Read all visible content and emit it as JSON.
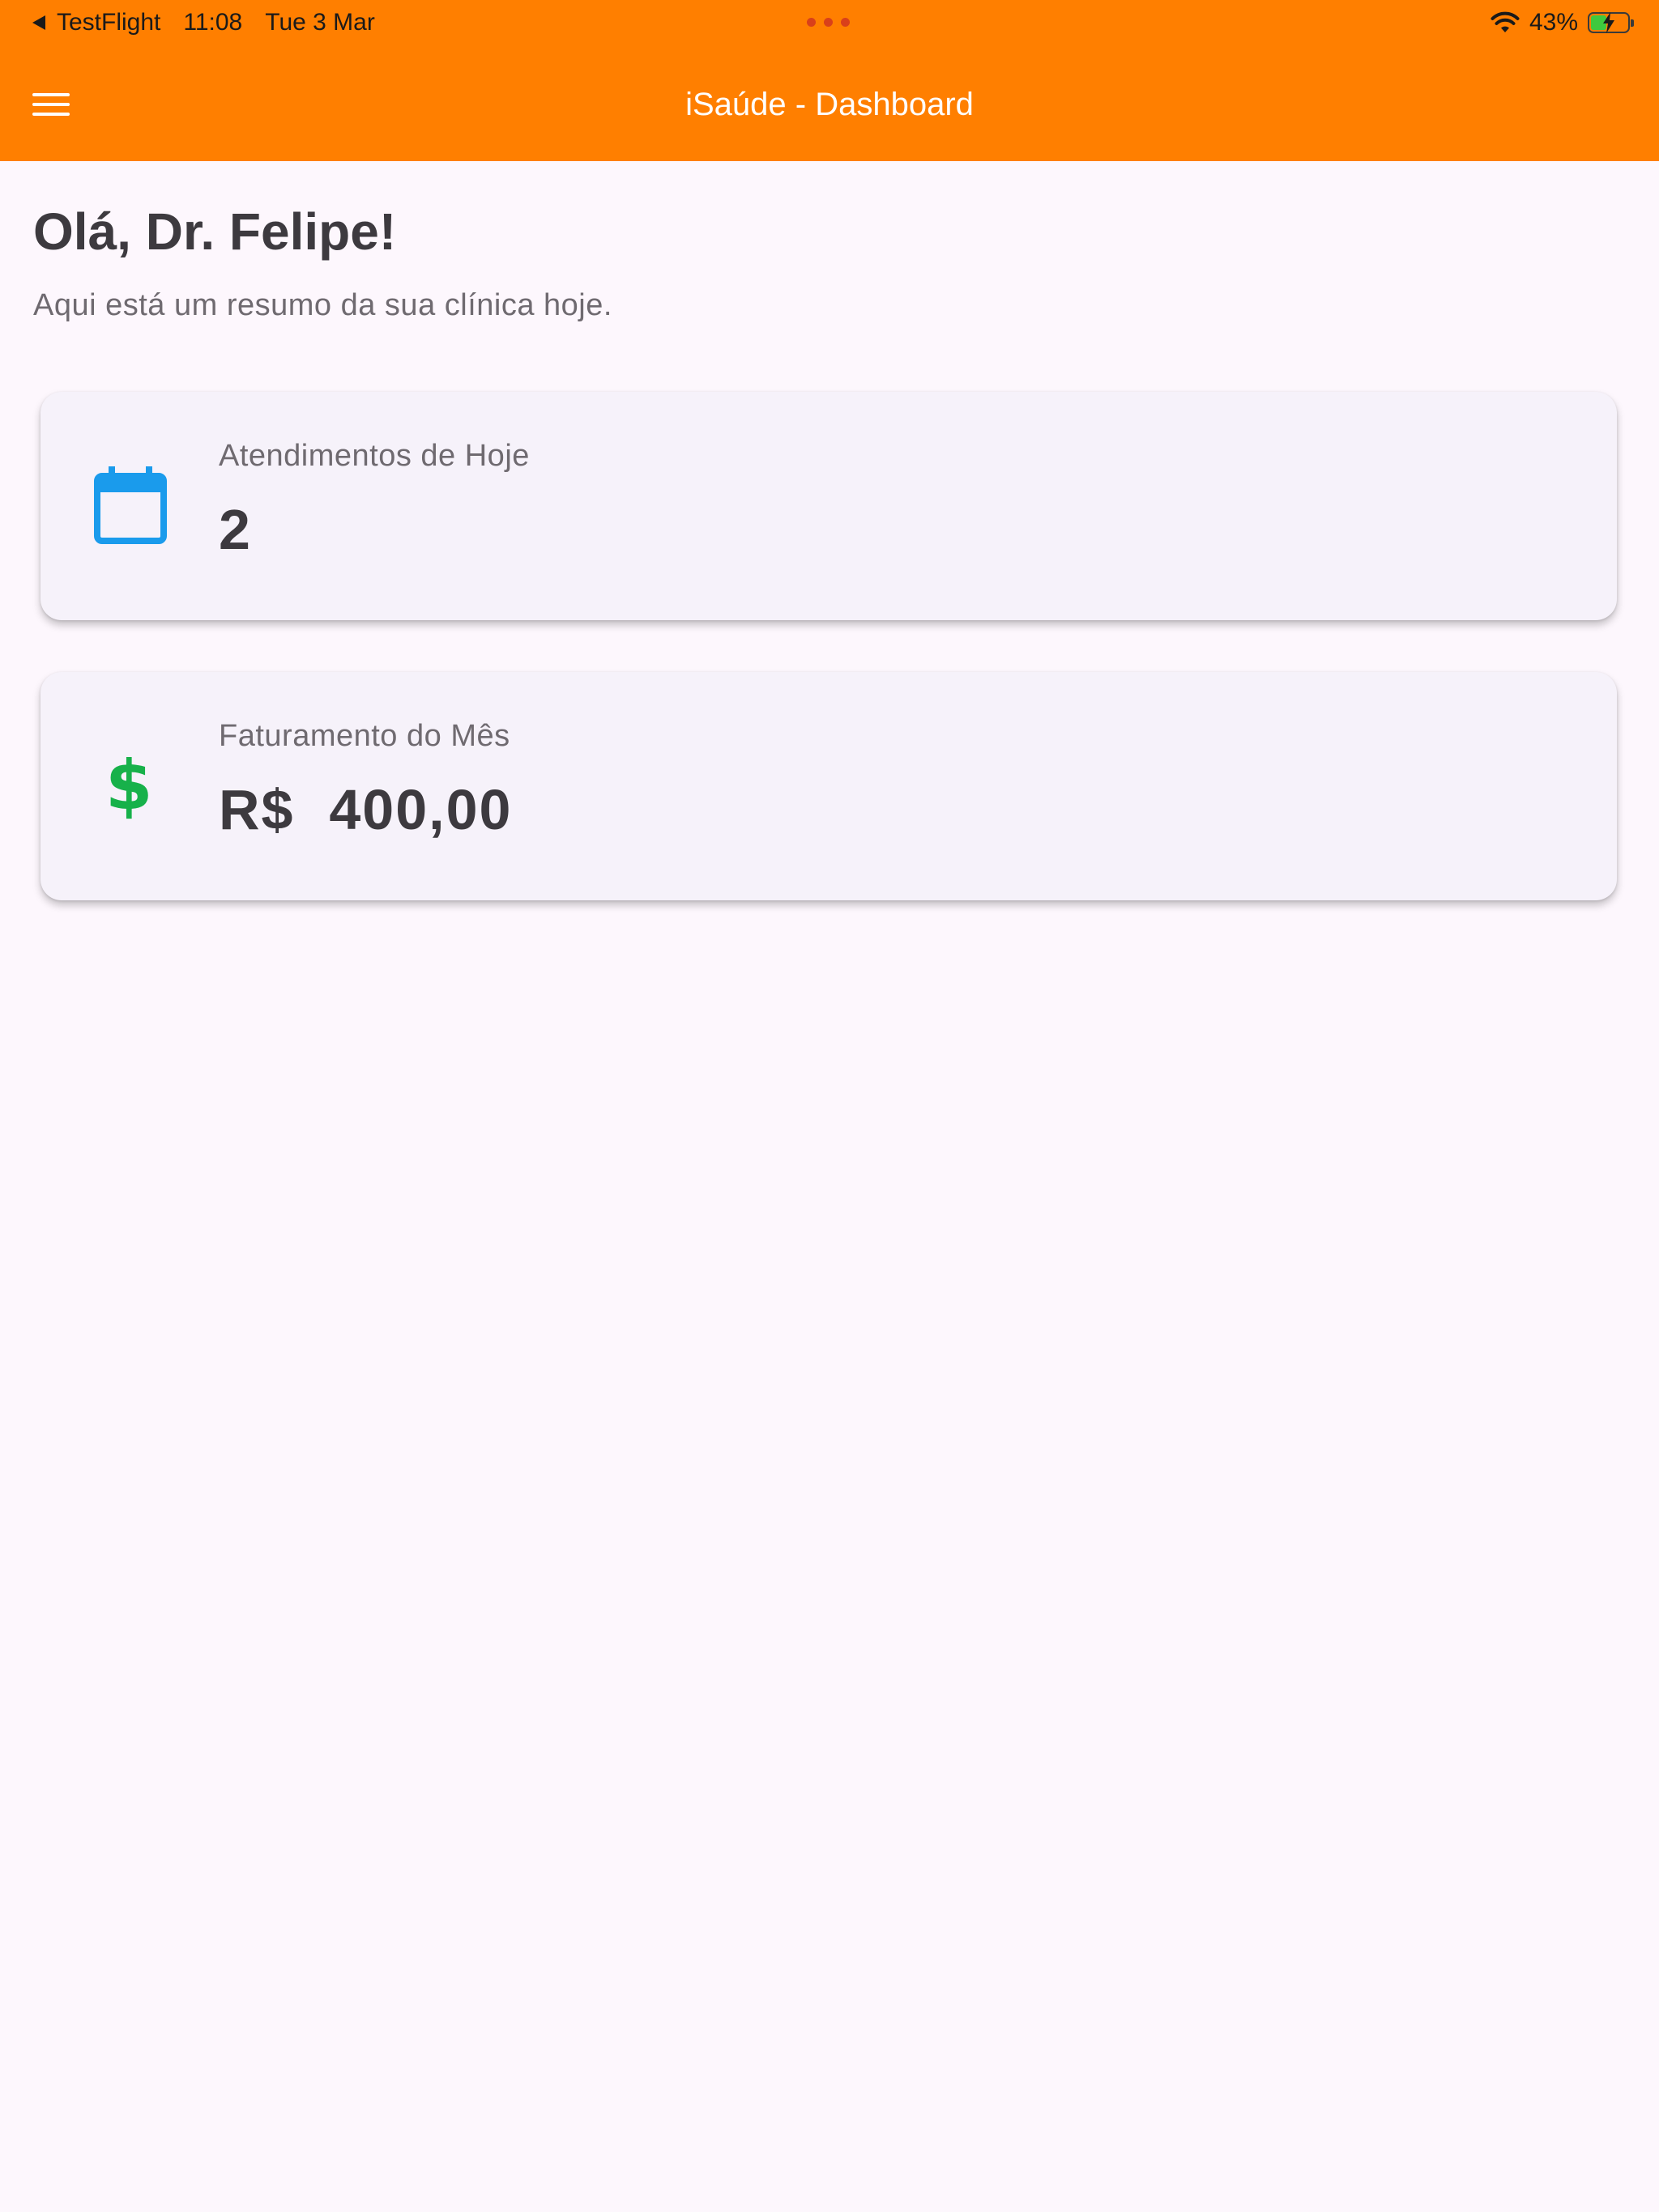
{
  "status_bar": {
    "back_app": "TestFlight",
    "time": "11:08",
    "date": "Tue 3 Mar",
    "battery_percent": "43%",
    "battery_level": 0.43
  },
  "app_bar": {
    "title": "iSaúde - Dashboard",
    "menu_icon": "menu-icon"
  },
  "header": {
    "greeting": "Olá, Dr. Felipe!",
    "subtitle": "Aqui está um resumo da sua clínica hoje."
  },
  "cards": [
    {
      "label": "Atendimentos de Hoje",
      "value": "2",
      "icon": "calendar-icon",
      "icon_color": "#1a9bec"
    },
    {
      "label": "Faturamento do Mês",
      "value": "R$  400,00",
      "icon": "dollar-icon",
      "icon_color": "#17b14a"
    }
  ],
  "colors": {
    "app_bar": "#ff7f00",
    "background": "#fdf7fd",
    "card": "#f6f2fa"
  }
}
